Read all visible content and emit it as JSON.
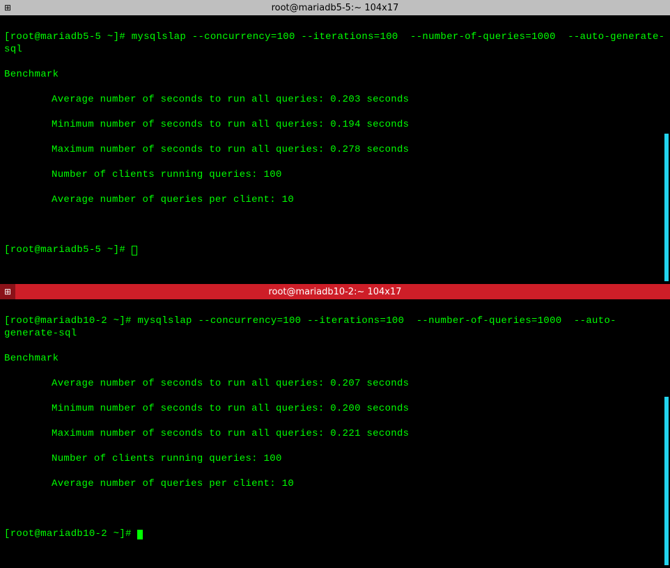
{
  "pane1": {
    "title": "root@mariadb5-5:~ 104x17",
    "prompt": "[root@mariadb5-5 ~]#",
    "command": "mysqlslap --concurrency=100 --iterations=100  --number-of-queries=1000  --auto-generate-sql",
    "benchmark_label": "Benchmark",
    "lines": {
      "avg": "Average number of seconds to run all queries: 0.203 seconds",
      "min": "Minimum number of seconds to run all queries: 0.194 seconds",
      "max": "Maximum number of seconds to run all queries: 0.278 seconds",
      "clients": "Number of clients running queries: 100",
      "per_client": "Average number of queries per client: 10"
    },
    "prompt2": "[root@mariadb5-5 ~]#"
  },
  "pane2": {
    "title": "root@mariadb10-2:~ 104x17",
    "prompt": "[root@mariadb10-2 ~]#",
    "command": "mysqlslap --concurrency=100 --iterations=100  --number-of-queries=1000  --auto-generate-sql",
    "benchmark_label": "Benchmark",
    "lines": {
      "avg": "Average number of seconds to run all queries: 0.207 seconds",
      "min": "Minimum number of seconds to run all queries: 0.200 seconds",
      "max": "Maximum number of seconds to run all queries: 0.221 seconds",
      "clients": "Number of clients running queries: 100",
      "per_client": "Average number of queries per client: 10"
    },
    "prompt2": "[root@mariadb10-2 ~]#"
  }
}
